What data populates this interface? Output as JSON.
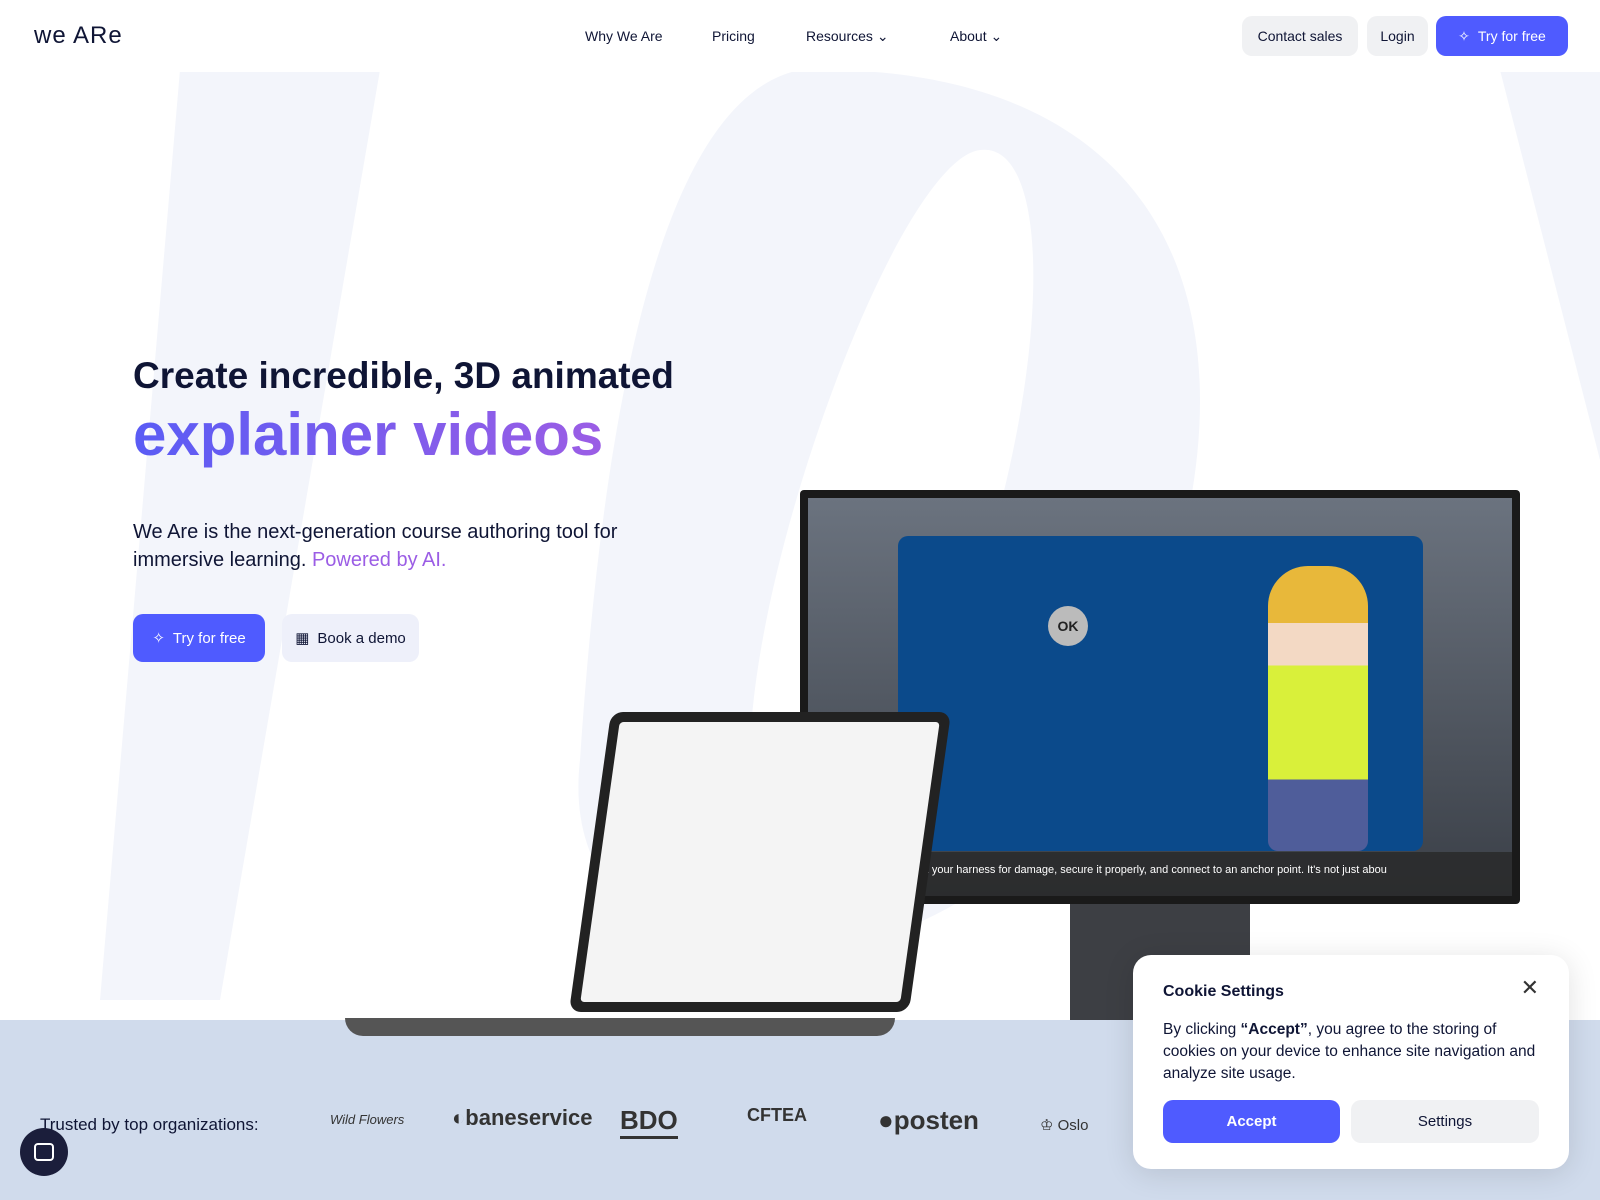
{
  "header": {
    "logo": "we ARe",
    "nav": [
      "Why We Are",
      "Pricing",
      "Resources",
      "About"
    ],
    "contact": "Contact sales",
    "login": "Login",
    "try": "Try for free"
  },
  "hero": {
    "title_line1": "Create incredible, 3D animated",
    "title_line2": "explainer videos",
    "description": "We Are is the next-generation course authoring tool for immersive learning.",
    "powered": "Powered by AI.",
    "try": "Try for free",
    "demo": "Book a demo"
  },
  "video": {
    "badge": "OK",
    "subtitle": "pect your harness for damage, secure it properly, and connect to an anchor point. It's not just abou"
  },
  "trusted": {
    "label": "Trusted by top organizations:",
    "logos": [
      "Wild Flowers",
      "baneservice",
      "BDO",
      "CFTEA",
      "posten",
      "Oslo"
    ]
  },
  "cookie": {
    "title": "Cookie Settings",
    "text_before": "By clicking ",
    "accept_word": "“Accept”",
    "text_after": ", you agree to the storing of cookies on your device to enhance site navigation and analyze site usage.",
    "accept": "Accept",
    "settings": "Settings"
  },
  "colors": {
    "accent": "#4f5bff",
    "gradient_end": "#9b5de5",
    "band": "#d0dbec"
  }
}
